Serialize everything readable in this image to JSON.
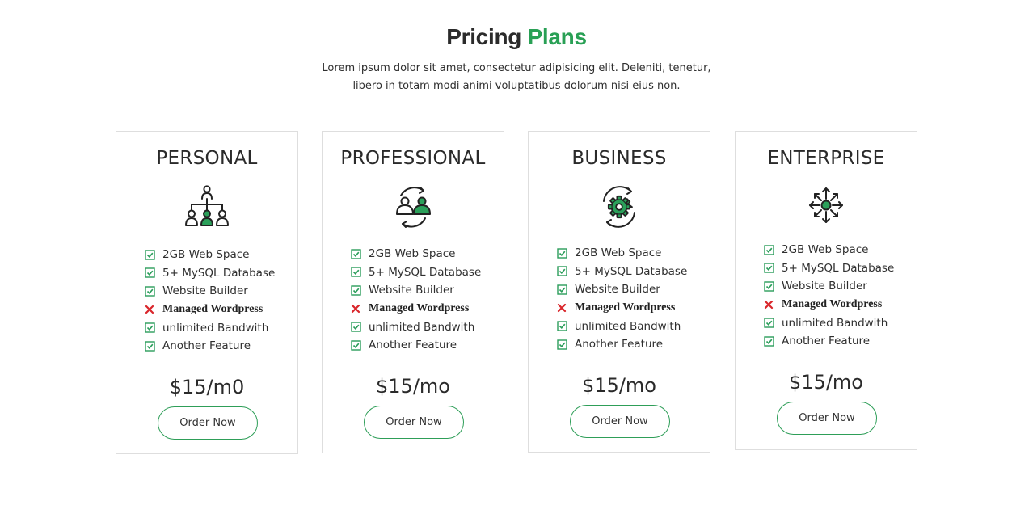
{
  "header": {
    "title_main": "Pricing",
    "title_accent": "Plans",
    "intro": "Lorem ipsum dolor sit amet, consectetur adipisicing elit. Deleniti, tenetur, libero in totam modi animi voluptatibus dolorum nisi eius non."
  },
  "colors": {
    "accent": "#29a055",
    "cross": "#d9262b",
    "border": "#dedede"
  },
  "plans": [
    {
      "name": "PERSONAL",
      "icon": "org-hierarchy-icon",
      "features": [
        {
          "label": "2GB Web Space",
          "included": true
        },
        {
          "label": "5+ MySQL Database",
          "included": true
        },
        {
          "label": "Website Builder",
          "included": true
        },
        {
          "label": "Managed Wordpress",
          "included": false
        },
        {
          "label": "unlimited Bandwith",
          "included": true
        },
        {
          "label": "Another Feature",
          "included": true
        }
      ],
      "price": "$15/m0",
      "button": "Order Now"
    },
    {
      "name": "PROFESSIONAL",
      "icon": "user-exchange-icon",
      "features": [
        {
          "label": "2GB Web Space",
          "included": true
        },
        {
          "label": "5+ MySQL Database",
          "included": true
        },
        {
          "label": "Website Builder",
          "included": true
        },
        {
          "label": "Managed Wordpress",
          "included": false
        },
        {
          "label": "unlimited Bandwith",
          "included": true
        },
        {
          "label": "Another Feature",
          "included": true
        }
      ],
      "price": "$15/mo",
      "button": "Order Now"
    },
    {
      "name": "BUSINESS",
      "icon": "gear-cycle-icon",
      "features": [
        {
          "label": "2GB Web Space",
          "included": true
        },
        {
          "label": "5+ MySQL Database",
          "included": true
        },
        {
          "label": "Website Builder",
          "included": true
        },
        {
          "label": "Managed Wordpress",
          "included": false
        },
        {
          "label": "unlimited Bandwith",
          "included": true
        },
        {
          "label": "Another Feature",
          "included": true
        }
      ],
      "price": "$15/mo",
      "button": "Order Now"
    },
    {
      "name": "ENTERPRISE",
      "icon": "expand-network-icon",
      "features": [
        {
          "label": "2GB Web Space",
          "included": true
        },
        {
          "label": "5+ MySQL Database",
          "included": true
        },
        {
          "label": "Website Builder",
          "included": true
        },
        {
          "label": "Managed Wordpress",
          "included": false
        },
        {
          "label": "unlimited Bandwith",
          "included": true
        },
        {
          "label": "Another Feature",
          "included": true
        }
      ],
      "price": "$15/mo",
      "button": "Order Now"
    }
  ]
}
